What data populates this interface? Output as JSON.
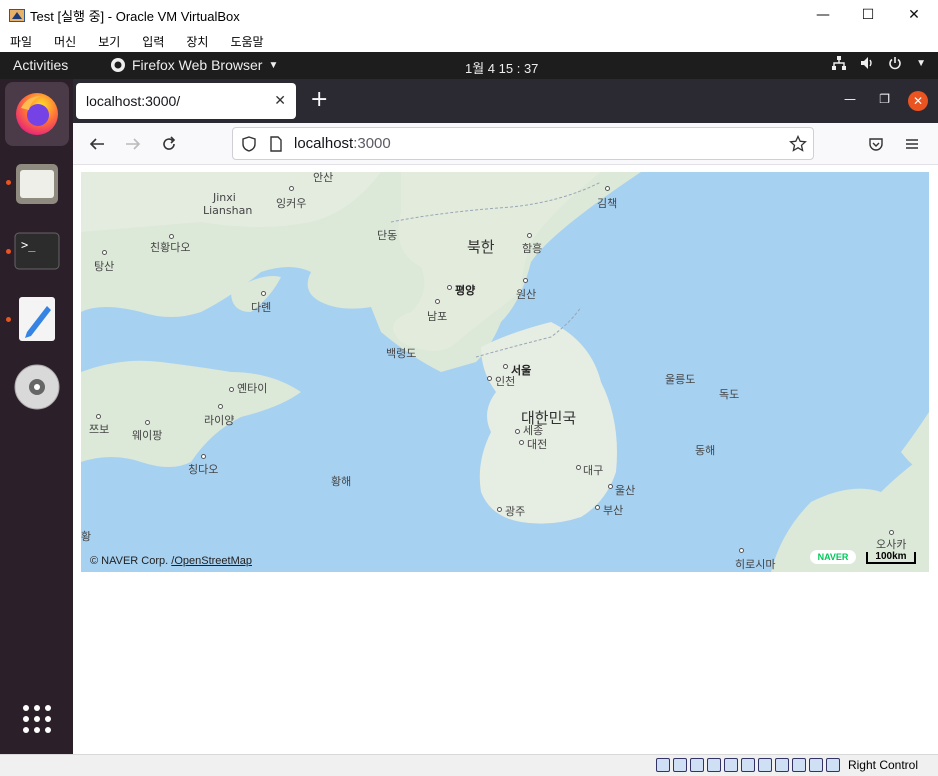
{
  "vbox": {
    "title": "Test [실행 중] - Oracle VM VirtualBox",
    "menu": [
      "파일",
      "머신",
      "보기",
      "입력",
      "장치",
      "도움말"
    ],
    "host_key": "Right Control"
  },
  "gnome": {
    "activities": "Activities",
    "app_name": "Firefox Web Browser",
    "clock": "1월 4  15 : 37"
  },
  "dock": {
    "items": [
      "firefox",
      "files",
      "terminal",
      "text-editor",
      "optical-disc"
    ]
  },
  "firefox": {
    "tab_title": "localhost:3000/",
    "url_host": "localhost",
    "url_port": ":3000"
  },
  "map": {
    "labels": {
      "antai": "안산",
      "jinxi": "Jinxi",
      "lianshan": "Lianshan",
      "yingkou": "잉커우",
      "gimchaek": "김책",
      "chifeng": "친황다오",
      "dandong": "단동",
      "north_korea": "북한",
      "hamheung": "함흥",
      "tangshan": "탕산",
      "pyongyang": "평양",
      "wonsan": "원산",
      "dalian": "다롄",
      "nampo": "남포",
      "baengnyeongdo": "백령도",
      "seoul": "서울",
      "incheon": "인천",
      "ulleungdo": "울릉도",
      "dokdo": "독도",
      "yantai": "옌타이",
      "south_korea": "대한민국",
      "sejong": "세종",
      "daejeon": "대전",
      "zibo": "쯔보",
      "weifang": "웨이팡",
      "laiyang": "라이양",
      "east_sea": "동해",
      "qingdao": "칭다오",
      "daegu": "대구",
      "yellow_sea": "황해",
      "ulsan": "울산",
      "gwangju": "광주",
      "busan": "부산",
      "osaka": "오사카",
      "hiroshima": "히로시마",
      "edge": "황"
    },
    "attribution_prefix": "© NAVER Corp. ",
    "attribution_link": "/OpenStreetMap",
    "naver": "NAVER",
    "scale": "100km"
  }
}
